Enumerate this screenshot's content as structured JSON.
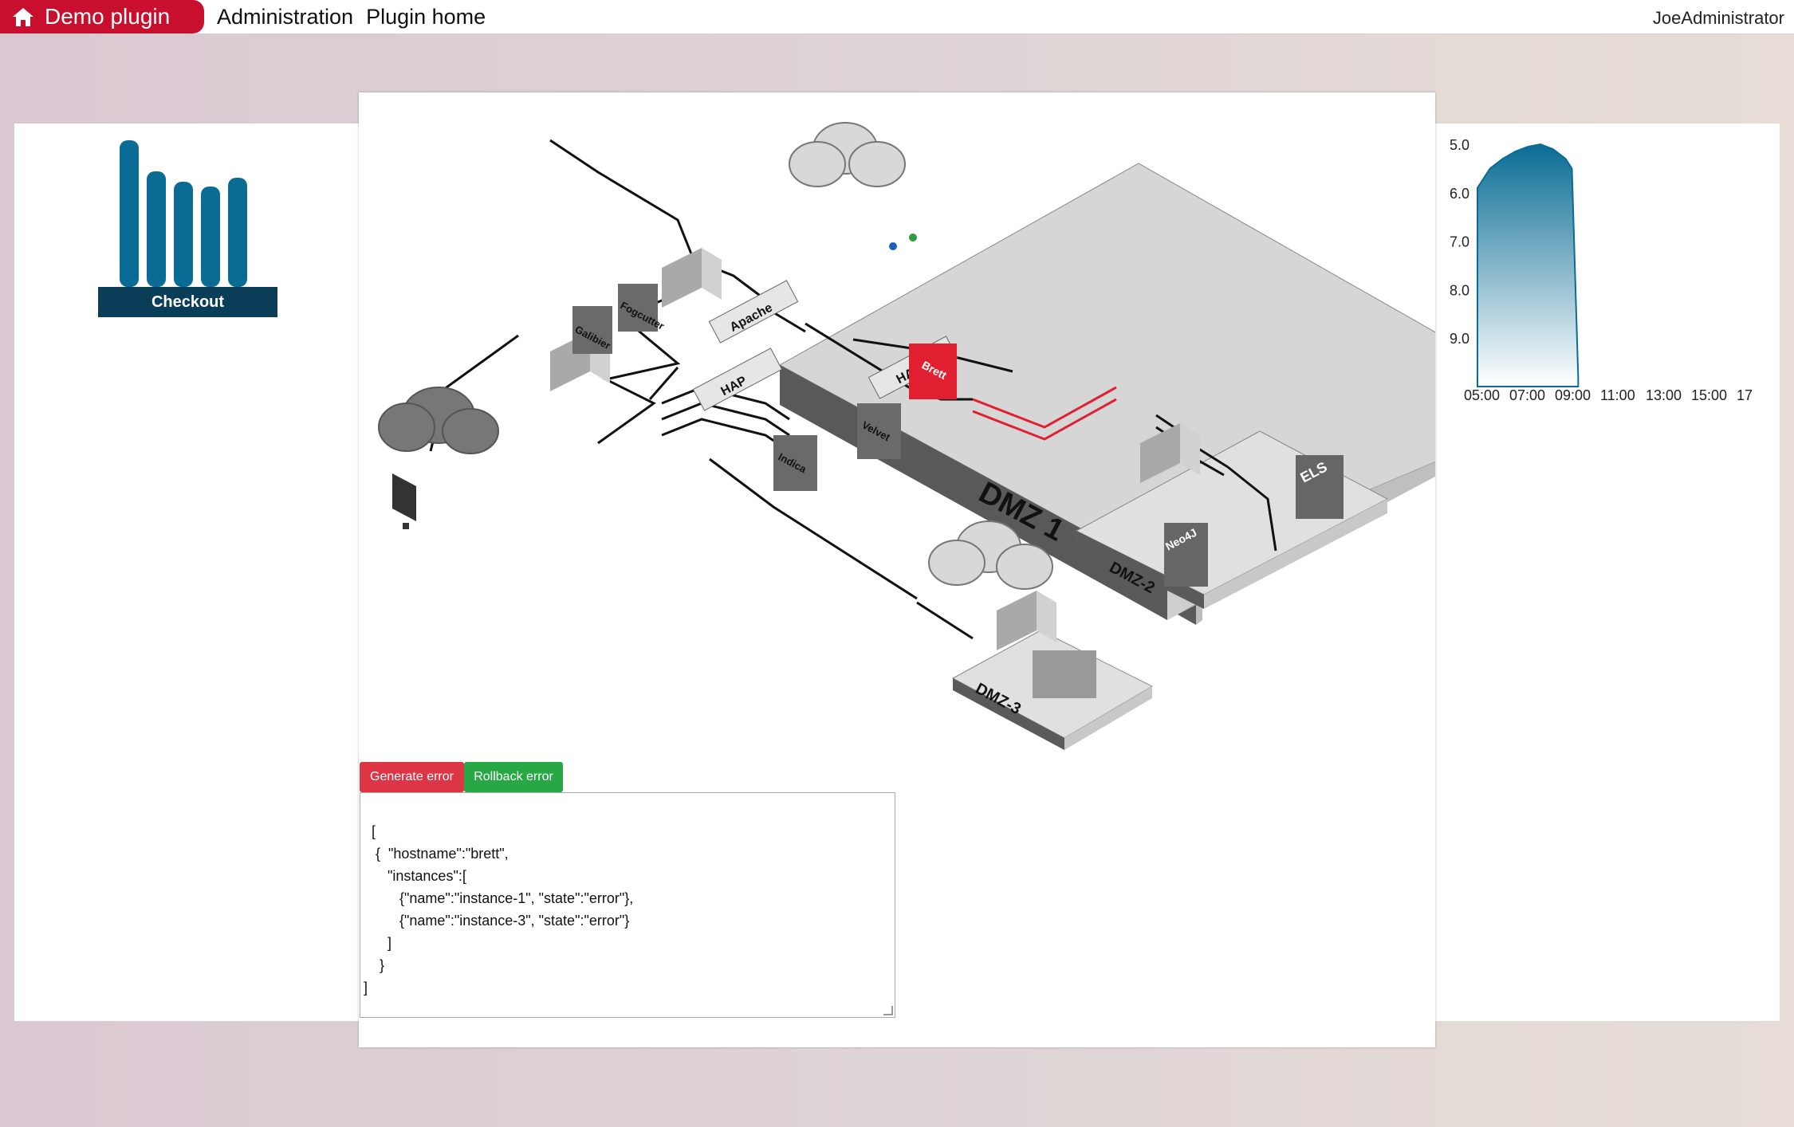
{
  "app": {
    "title": "Demo plugin",
    "nav": [
      "Administration",
      "Plugin home"
    ],
    "user": "JoeAdministrator"
  },
  "left_widget": {
    "label": "Checkout",
    "bars": [
      0.98,
      0.77,
      0.7,
      0.67,
      0.73
    ],
    "color": "#0a6c94"
  },
  "diagram": {
    "zones": [
      "DMZ 1",
      "DMZ-2",
      "DMZ-3"
    ],
    "nodes": [
      "Apache",
      "Galibier",
      "Fogcutter",
      "HAP",
      "HAP",
      "Brett",
      "Velvet",
      "Indica",
      "ELS",
      "Neo4J"
    ]
  },
  "buttons": {
    "generate": "Generate error",
    "rollback": "Rollback error"
  },
  "json_text": "[\n   {  \"hostname\":\"brett\",\n      \"instances\":[\n         {\"name\":\"instance-1\", \"state\":\"error\"},\n         {\"name\":\"instance-3\", \"state\":\"error\"}\n      ]\n    }\n]",
  "chart_data": {
    "type": "area",
    "x_tick_labels": [
      "05:00",
      "07:00",
      "09:00",
      "11:00",
      "13:00",
      "15:00",
      "17"
    ],
    "y_tick_labels": [
      "5.0",
      "6.0",
      "7.0",
      "8.0",
      "9.0"
    ],
    "ylim": [
      5.0,
      10.0
    ],
    "y_inverted": true,
    "x_hours": [
      5.0,
      5.5,
      6.0,
      6.5,
      7.0,
      7.5,
      8.0,
      8.5,
      8.75,
      9.0
    ],
    "y": [
      5.9,
      5.5,
      5.3,
      5.15,
      5.05,
      5.0,
      5.1,
      5.3,
      5.5,
      9.8
    ],
    "color": "#0a6c94"
  }
}
